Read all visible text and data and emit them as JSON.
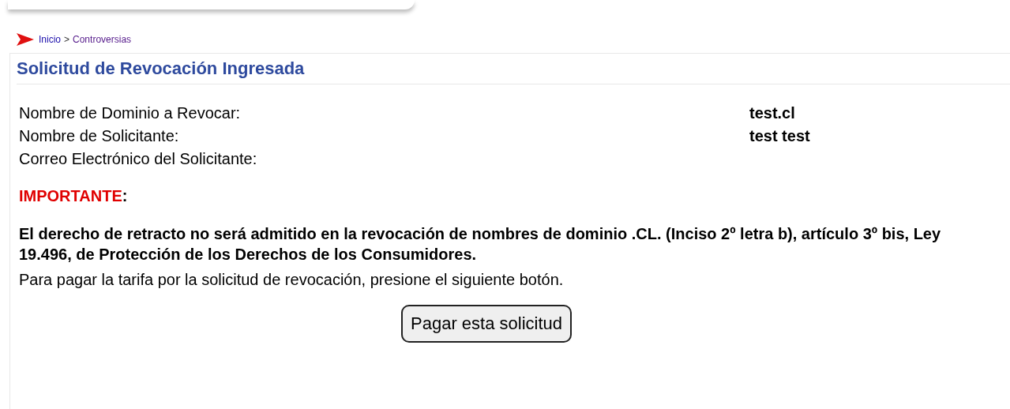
{
  "breadcrumb": {
    "links": [
      {
        "label": "Inicio",
        "visited": false
      },
      {
        "label": "Controversias",
        "visited": true
      }
    ],
    "separator": ">"
  },
  "title": "Solicitud de Revocación Ingresada",
  "fields": [
    {
      "label": "Nombre de Dominio a Revocar:",
      "value": "test.cl"
    },
    {
      "label": "Nombre de Solicitante:",
      "value": "test test"
    },
    {
      "label": "Correo Electrónico del Solicitante:"
    }
  ],
  "important": {
    "label": "IMPORTANTE",
    "suffix": ":"
  },
  "notice": "El derecho de retracto no será admitido en la revocación de nombres de dominio .CL. (Inciso 2º letra b), artículo 3º bis, Ley 19.496, de Protección de los Derechos de los Consumidores.",
  "instruction": "Para pagar la tarifa por la solicitud de revocación, presione el siguiente botón.",
  "button": "Pagar esta solicitud"
}
